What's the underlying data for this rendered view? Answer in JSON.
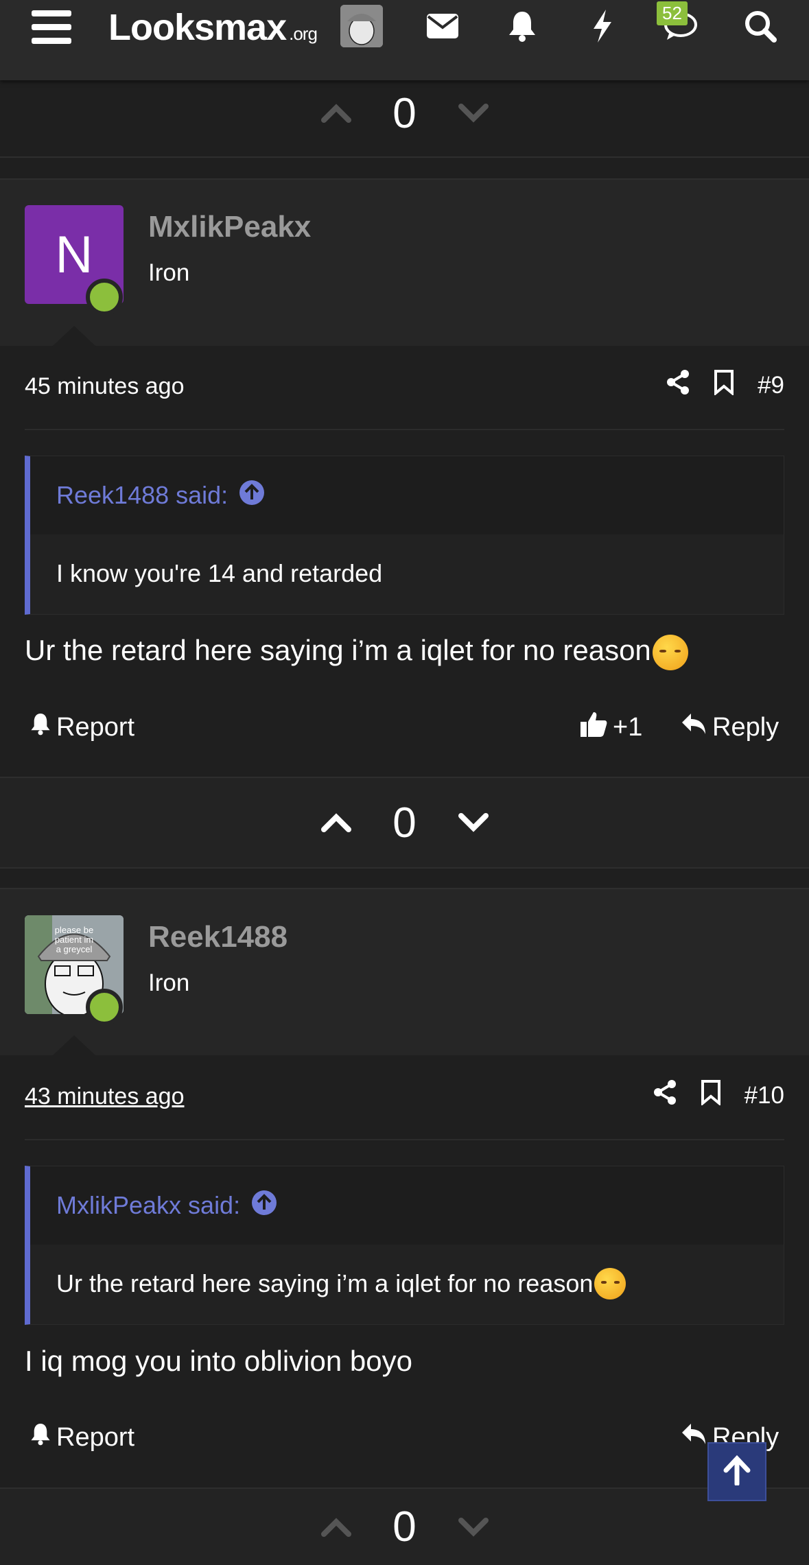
{
  "nav": {
    "logo_main": "Looksmax",
    "logo_tld": ".org",
    "alerts_badge": "52"
  },
  "votes": {
    "top": "0",
    "middle": "0",
    "bottom": "0"
  },
  "posts": [
    {
      "avatar_letter": "N",
      "avatar_color": "#7a2ea8",
      "username": "MxlikPeakx",
      "user_title": "Iron",
      "time": "45 minutes ago",
      "post_number": "#9",
      "quote_author": "Reek1488 said:",
      "quote_text": "I know you're 14 and retarded",
      "body": "Ur the retard here saying i’m a iqlet for no reason",
      "report_label": "Report",
      "like_label": "+1",
      "reply_label": "Reply"
    },
    {
      "avatar_caption": "please be patient im a greycel",
      "username": "Reek1488",
      "user_title": "Iron",
      "time": "43 minutes ago",
      "post_number": "#10",
      "quote_author": "MxlikPeakx said:",
      "quote_text": "Ur the retard here saying i’m a iqlet for no reason",
      "body": "I iq mog you into oblivion boyo",
      "report_label": "Report",
      "reply_label": "Reply"
    }
  ],
  "colors": {
    "accent": "#6f7bd8",
    "online": "#8cbf3c",
    "background": "#1f1f1f"
  },
  "icons": [
    "menu-icon",
    "envelope-icon",
    "bell-icon",
    "bolt-icon",
    "chat-icon",
    "search-icon",
    "share-icon",
    "bookmark-icon",
    "thumbs-up-icon",
    "reply-icon",
    "arrow-up-icon"
  ]
}
